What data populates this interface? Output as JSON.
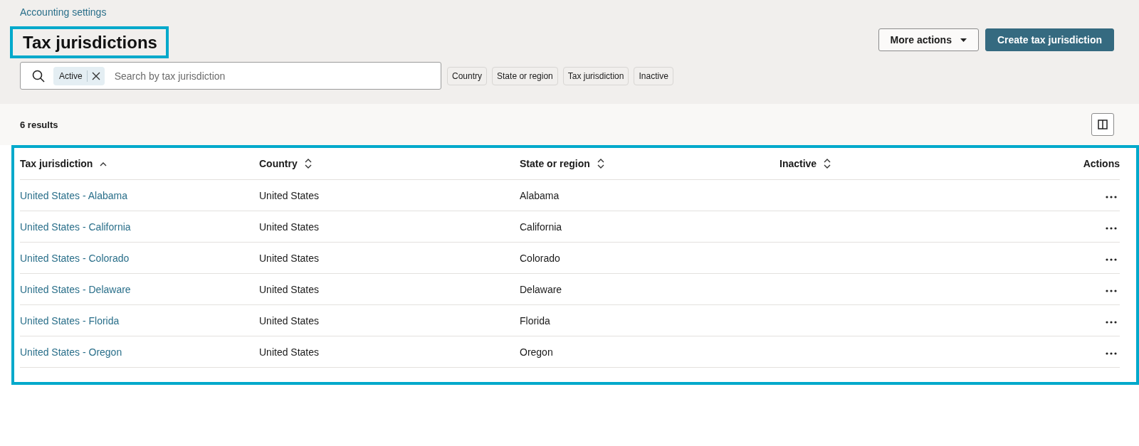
{
  "breadcrumb": "Accounting settings",
  "title": {
    "text": "Tax jurisdictions",
    "highlighted": true
  },
  "header_buttons": [
    {
      "label": "More actions",
      "kind": "menu"
    },
    {
      "label": "Create tax jurisdiction",
      "kind": "primary"
    }
  ],
  "search": {
    "placeholder": "Search by tax jurisdiction",
    "chips": [
      "Active"
    ]
  },
  "filters": [
    "Country",
    "State or region",
    "Tax jurisdiction",
    "Inactive"
  ],
  "results_count": "6 results",
  "table": {
    "highlighted": true,
    "columns": [
      {
        "label": "Tax jurisdiction",
        "kind": "ascending"
      },
      {
        "label": "Country",
        "kind": "sortable"
      },
      {
        "label": "State or region",
        "kind": "sortable"
      },
      {
        "label": "Inactive",
        "kind": "sortable"
      },
      {
        "label": "Actions",
        "kind": "plain"
      }
    ],
    "rows": [
      {
        "tax_jurisdiction": "United States - Alabama",
        "country": "United States",
        "state_or_region": "Alabama"
      },
      {
        "tax_jurisdiction": "United States - California",
        "country": "United States",
        "state_or_region": "California"
      },
      {
        "tax_jurisdiction": "United States - Colorado",
        "country": "United States",
        "state_or_region": "Colorado"
      },
      {
        "tax_jurisdiction": "United States - Delaware",
        "country": "United States",
        "state_or_region": "Delaware"
      },
      {
        "tax_jurisdiction": "United States - Florida",
        "country": "United States",
        "state_or_region": "Florida"
      },
      {
        "tax_jurisdiction": "United States - Oregon",
        "country": "United States",
        "state_or_region": "Oregon"
      }
    ]
  }
}
